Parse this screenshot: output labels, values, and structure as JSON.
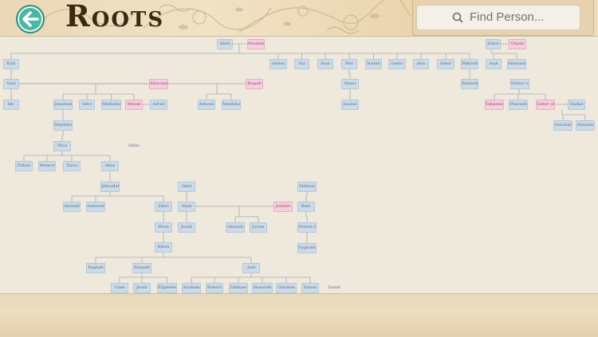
{
  "app": {
    "title": "Roots",
    "back_icon": "back-arrow-icon",
    "accent": "#4bb7a2"
  },
  "search": {
    "placeholder": "Find Person...",
    "icon": "search-icon"
  },
  "colors": {
    "male": "#ccdbe8",
    "female": "#f6cedd",
    "line": "#a9a9a9"
  },
  "people": [
    {
      "id": "abiel",
      "name": "Abiel",
      "g": "m"
    },
    {
      "id": "maakah",
      "name": "Maakah",
      "g": "f"
    },
    {
      "id": "kilion",
      "name": "Kilion",
      "g": "m"
    },
    {
      "id": "orpah",
      "name": "Orpah",
      "g": "f"
    },
    {
      "id": "kish",
      "name": "Kish",
      "g": "m"
    },
    {
      "id": "abdon",
      "name": "Abdon",
      "g": "m"
    },
    {
      "id": "zur",
      "name": "Zur",
      "g": "m"
    },
    {
      "id": "baal",
      "name": "Baal",
      "g": "m"
    },
    {
      "id": "ner",
      "name": "Ner",
      "g": "m"
    },
    {
      "id": "nadab",
      "name": "Nadab",
      "g": "m"
    },
    {
      "id": "gedor",
      "name": "Gedor",
      "g": "m"
    },
    {
      "id": "ahio",
      "name": "Ahio",
      "g": "m"
    },
    {
      "id": "zeker",
      "name": "Zeker",
      "g": "m"
    },
    {
      "id": "mikloth",
      "name": "Mikloth",
      "g": "m"
    },
    {
      "id": "aiah",
      "name": "Aiah",
      "g": "m"
    },
    {
      "id": "abinoam",
      "name": "Abinoam",
      "g": "m"
    },
    {
      "id": "saul",
      "name": "Saul",
      "g": "m"
    },
    {
      "id": "ahinoam",
      "name": "Ahinoam",
      "g": "f"
    },
    {
      "id": "rizpah",
      "name": "Rizpah",
      "g": "f"
    },
    {
      "id": "abner",
      "name": "Abner",
      "g": "m"
    },
    {
      "id": "shimeah",
      "name": "Shimeah",
      "g": "m"
    },
    {
      "id": "father_of",
      "name": "Father of",
      "g": "m"
    },
    {
      "id": "ishbo",
      "name": "Ish-",
      "g": "m"
    },
    {
      "id": "jonathan",
      "name": "Jonathan",
      "g": "m"
    },
    {
      "id": "ishvi",
      "name": "Ishvi",
      "g": "m"
    },
    {
      "id": "malkishua",
      "name": "Malkishua",
      "g": "m"
    },
    {
      "id": "merab",
      "name": "Merab",
      "g": "f"
    },
    {
      "id": "adriel",
      "name": "Adriel",
      "g": "m"
    },
    {
      "id": "armoni",
      "name": "Armoni",
      "g": "m"
    },
    {
      "id": "mephibo",
      "name": "Mephibo",
      "g": "m"
    },
    {
      "id": "jaasiel",
      "name": "Jaasiel",
      "g": "m"
    },
    {
      "id": "tahpenes",
      "name": "Tahpenes",
      "g": "f"
    },
    {
      "id": "pharaoh",
      "name": "Pharaoh",
      "g": "m"
    },
    {
      "id": "sister_of",
      "name": "Sister of",
      "g": "f"
    },
    {
      "id": "hadad",
      "name": "Hadad",
      "g": "m"
    },
    {
      "id": "genubath",
      "name": "Genubath",
      "g": "m"
    },
    {
      "id": "abinadab",
      "name": "Abinada",
      "g": "m"
    },
    {
      "id": "mephibosheth",
      "name": "Mephibo",
      "g": "m"
    },
    {
      "id": "mica",
      "name": "Mica",
      "g": "m"
    },
    {
      "id": "shillo",
      "name": "Shillo",
      "g": "n"
    },
    {
      "id": "pithon",
      "name": "Pithon",
      "g": "m"
    },
    {
      "id": "melech",
      "name": "Melech",
      "g": "m"
    },
    {
      "id": "tarea",
      "name": "Tarea",
      "g": "m"
    },
    {
      "id": "ahaz",
      "name": "Ahaz",
      "g": "m"
    },
    {
      "id": "jehoadah",
      "name": "Jehoadah",
      "g": "m"
    },
    {
      "id": "omri",
      "name": "Omri",
      "g": "m"
    },
    {
      "id": "ethbaal",
      "name": "Ethbaal",
      "g": "m"
    },
    {
      "id": "alemeth",
      "name": "Alemeth",
      "g": "m"
    },
    {
      "id": "azmaveth",
      "name": "Azmaveth",
      "g": "m"
    },
    {
      "id": "zimri",
      "name": "Zimri",
      "g": "m"
    },
    {
      "id": "ahab",
      "name": "Ahab",
      "g": "m"
    },
    {
      "id": "jezebel",
      "name": "Jezebel",
      "g": "f"
    },
    {
      "id": "baal2",
      "name": "Baal-",
      "g": "m"
    },
    {
      "id": "joash",
      "name": "Joash",
      "g": "m"
    },
    {
      "id": "ahaziah",
      "name": "Ahaziah",
      "g": "m"
    },
    {
      "id": "joram",
      "name": "Joram",
      "g": "m"
    },
    {
      "id": "moza",
      "name": "Moza",
      "g": "m"
    },
    {
      "id": "mattan",
      "name": "Mattan I",
      "g": "m"
    },
    {
      "id": "binea",
      "name": "Binea",
      "g": "m"
    },
    {
      "id": "pygmalion",
      "name": "Pygmalio",
      "g": "m"
    },
    {
      "id": "raphah",
      "name": "Raphah",
      "g": "m"
    },
    {
      "id": "eleasah",
      "name": "Eleasah",
      "g": "m"
    },
    {
      "id": "azel",
      "name": "Azel",
      "g": "m"
    },
    {
      "id": "ulam",
      "name": "Ulam",
      "g": "m"
    },
    {
      "id": "jeush",
      "name": "Jeush",
      "g": "m"
    },
    {
      "id": "eliphelet",
      "name": "Eliphelet",
      "g": "m"
    },
    {
      "id": "azrikam",
      "name": "Azrikam",
      "g": "m"
    },
    {
      "id": "bokeru",
      "name": "Bokeru",
      "g": "m"
    },
    {
      "id": "ishmael",
      "name": "Ishmael",
      "g": "m"
    },
    {
      "id": "sheariah",
      "name": "Sheariah",
      "g": "m"
    },
    {
      "id": "obadiah",
      "name": "Obadiah",
      "g": "m"
    },
    {
      "id": "hanan",
      "name": "Hanan",
      "g": "m"
    },
    {
      "id": "zadok",
      "name": "Zadok",
      "g": "n"
    }
  ]
}
